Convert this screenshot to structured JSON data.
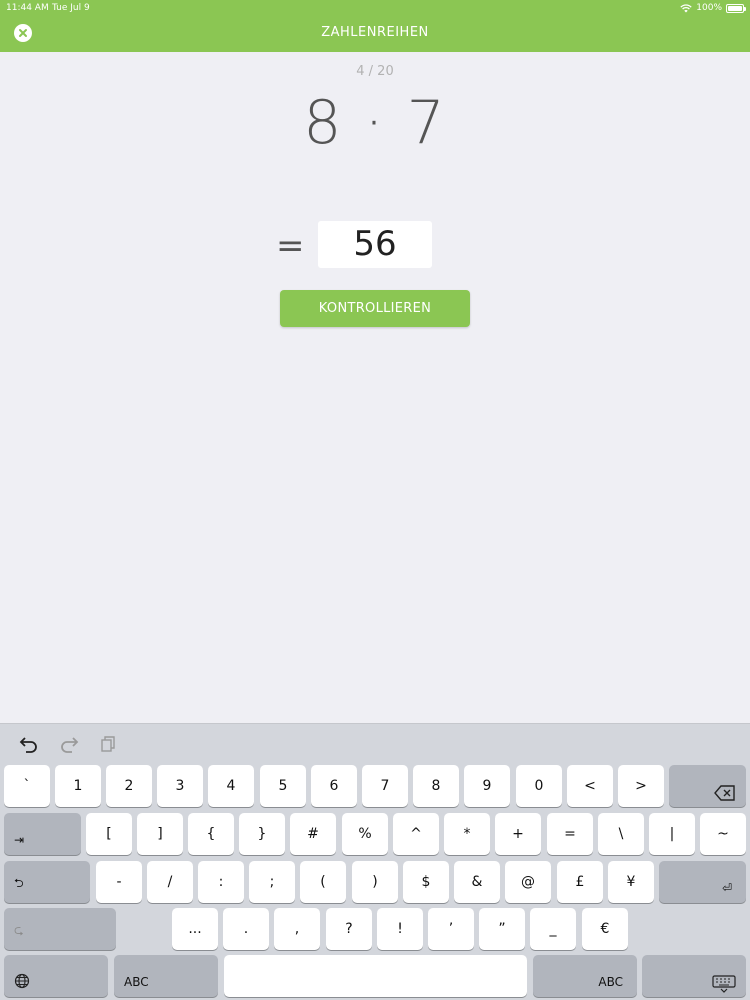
{
  "status_bar": {
    "time": "11:44 AM",
    "date": "Tue Jul 9",
    "battery": "100%"
  },
  "header": {
    "title": "ZAHLENREIHEN",
    "close_icon": "close-circle-icon",
    "color": "#8bc653"
  },
  "main": {
    "progress": "4 / 20",
    "problem": "8 · 7",
    "equals": "=",
    "answer": "56",
    "check_label": "KONTROLLIEREN"
  },
  "keyboard": {
    "toolbar_icons": [
      "undo-icon",
      "redo-icon",
      "paste-icon"
    ],
    "row1": [
      "`",
      "1",
      "2",
      "3",
      "4",
      "5",
      "6",
      "7",
      "8",
      "9",
      "0",
      "<",
      ">"
    ],
    "row2": [
      "[",
      "]",
      "{",
      "}",
      "#",
      "%",
      "^",
      "*",
      "+",
      "=",
      "\\",
      "|",
      "~"
    ],
    "row3": [
      "-",
      "/",
      ":",
      ";",
      "(",
      ")",
      "$",
      "&",
      "@",
      "£",
      "¥"
    ],
    "row4": [
      "...",
      ".",
      ",",
      "?",
      "!",
      "’",
      "”",
      "_",
      "€"
    ],
    "abc_left": "ABC",
    "abc_right": "ABC",
    "icons": {
      "backspace": "⌫",
      "tab": "⇥",
      "undo": "⮌",
      "redo": "⮎",
      "return": "⏎",
      "globe": "🌐",
      "dismiss": "⌨"
    }
  }
}
